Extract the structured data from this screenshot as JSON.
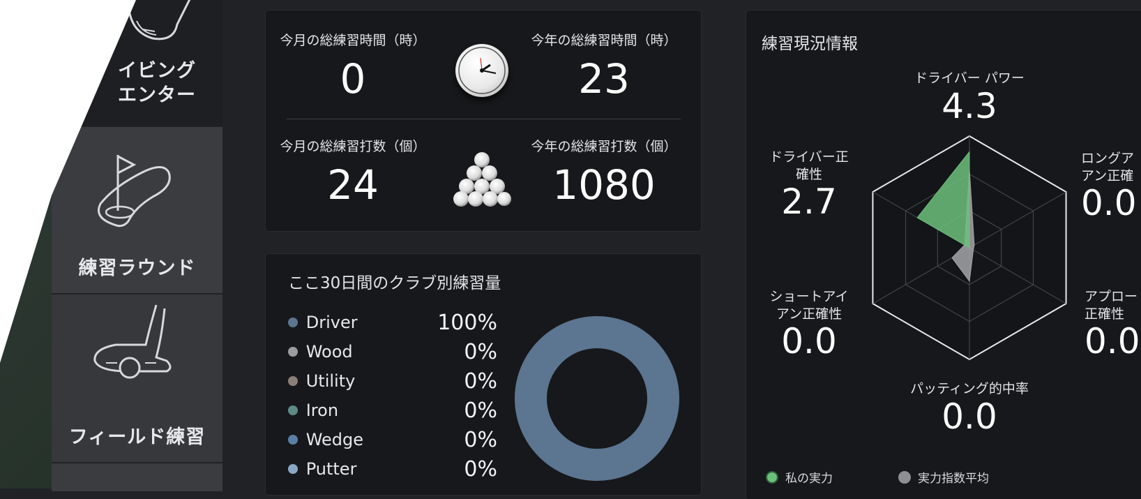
{
  "sidebar": {
    "items": [
      {
        "label": "イビング\nエンター",
        "icon": "driver-club-icon"
      },
      {
        "label": "練習ラウンド",
        "icon": "golf-hole-flag-icon"
      },
      {
        "label": "フィールド練習",
        "icon": "putter-ball-icon"
      },
      {
        "label": "",
        "icon": ""
      }
    ]
  },
  "stats": {
    "month_hours_label": "今月の総練習時間（時）",
    "month_hours": "0",
    "year_hours_label": "今年の総練習時間（時）",
    "year_hours": "23",
    "month_shots_label": "今月の総練習打数（個）",
    "month_shots": "24",
    "year_shots_label": "今年の総練習打数（個）",
    "year_shots": "1080",
    "clock_icon": "clock-icon",
    "balls_icon": "golf-balls-pyramid-icon"
  },
  "club_usage": {
    "title": "ここ30日間のクラブ別練習量",
    "rows": [
      {
        "name": "Driver",
        "pct": "100%",
        "value": 100,
        "color": "#5c7590"
      },
      {
        "name": "Wood",
        "pct": "0%",
        "value": 0,
        "color": "#9a9ca0"
      },
      {
        "name": "Utility",
        "pct": "0%",
        "value": 0,
        "color": "#8a7f78"
      },
      {
        "name": "Iron",
        "pct": "0%",
        "value": 0,
        "color": "#5f8a86"
      },
      {
        "name": "Wedge",
        "pct": "0%",
        "value": 0,
        "color": "#5b7fa4"
      },
      {
        "name": "Putter",
        "pct": "0%",
        "value": 0,
        "color": "#8aa6c4"
      }
    ]
  },
  "radar": {
    "title": "練習現況情報",
    "axes": [
      {
        "label": "ドライバー パワー",
        "value": "4.3"
      },
      {
        "label": "ロングア\nアン正確",
        "value": "0.0"
      },
      {
        "label": "アプロー\n正確性",
        "value": "0.0"
      },
      {
        "label": "パッティング的中率",
        "value": "0.0"
      },
      {
        "label": "ショートアイ\nアン正確性",
        "value": "0.0"
      },
      {
        "label": "ドライバー正\n確性",
        "value": "2.7"
      }
    ],
    "legend": [
      {
        "label": "私の実力",
        "color": "#6cc07c"
      },
      {
        "label": "実力指数平均",
        "color": "#8d8f93"
      }
    ],
    "my_color": "#6cc07c",
    "avg_color": "#a3a5a8",
    "scale_max": 5,
    "my_values": [
      4.3,
      0,
      0,
      0,
      0,
      2.7
    ],
    "avg_values": [
      3.5,
      0.25,
      0.2,
      1.5,
      0.9,
      0.25
    ]
  }
}
